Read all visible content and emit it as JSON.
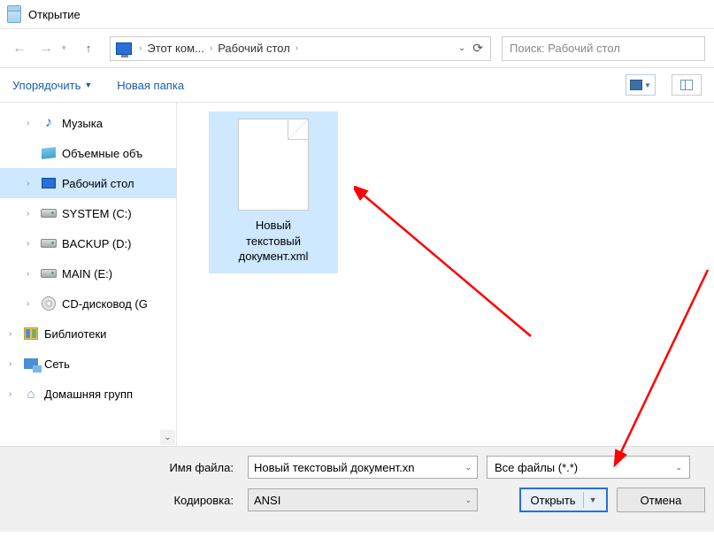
{
  "title": "Открытие",
  "nav": {
    "this_pc": "Этот ком...",
    "desktop": "Рабочий стол"
  },
  "search": {
    "placeholder": "Поиск: Рабочий стол"
  },
  "toolbar": {
    "organize": "Упорядочить",
    "new_folder": "Новая папка"
  },
  "tree": {
    "music": "Музыка",
    "volumes": "Объемные объ",
    "desktop": "Рабочий стол",
    "system": "SYSTEM (C:)",
    "backup": "BACKUP (D:)",
    "main": "MAIN (E:)",
    "cd": "CD-дисковод (G",
    "libraries": "Библиотеки",
    "network": "Сеть",
    "homegroup": "Домашняя групп"
  },
  "file": {
    "line1": "Новый",
    "line2": "текстовый",
    "line3": "документ.xml"
  },
  "footer": {
    "filename_label": "Имя файла:",
    "filename_value": "Новый текстовый документ.xn",
    "encoding_label": "Кодировка:",
    "encoding_value": "ANSI",
    "filetype": "Все файлы  (*.*)",
    "open": "Открыть",
    "cancel": "Отмена"
  }
}
